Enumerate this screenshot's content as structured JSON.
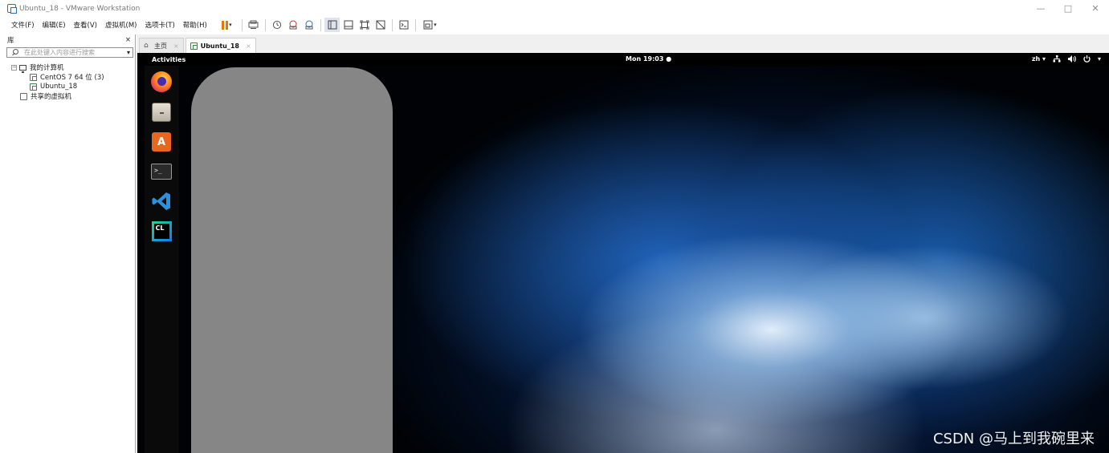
{
  "window": {
    "title": "Ubuntu_18 - VMware Workstation",
    "minimize": "—",
    "maximize": "□",
    "close": "✕"
  },
  "menu": [
    "文件(F)",
    "编辑(E)",
    "查看(V)",
    "虚拟机(M)",
    "选项卡(T)",
    "帮助(H)"
  ],
  "toolbar": {
    "icons": [
      "pause-icon",
      "send-keys-icon",
      "snapshot-icon",
      "revert-snapshot-icon",
      "manage-snapshots-icon",
      "library-view-icon",
      "thumbnail-view-icon",
      "fullscreen-icon",
      "unity-icon",
      "console-icon",
      "view-options-icon"
    ],
    "accent": "#e07a00"
  },
  "library": {
    "title": "库",
    "close": "×",
    "search_placeholder": "在此处键入内容进行搜索",
    "tree": {
      "root": "我的计算机",
      "vms": [
        "CentOS 7 64 位 (3)",
        "Ubuntu_18"
      ],
      "shared": "共享的虚拟机"
    }
  },
  "tabs": [
    {
      "label": "主页",
      "icon": "home-icon",
      "close": "×"
    },
    {
      "label": "Ubuntu_18",
      "icon": "vm-icon",
      "close": "×",
      "active": true
    }
  ],
  "guest": {
    "topbar": {
      "activities": "Activities",
      "clock": "Mon 19:03 ●",
      "lang": "zh ▾",
      "status_icons": [
        "network-icon",
        "volume-icon",
        "power-icon"
      ]
    },
    "dock": [
      "firefox-icon",
      "files-icon",
      "software-center-icon",
      "terminal-icon",
      "vscode-icon",
      "clion-icon"
    ],
    "terminal_prompt": ">_",
    "store_letter": "A",
    "clion_label": "CL"
  },
  "watermark": "CSDN @马上到我碗里来"
}
